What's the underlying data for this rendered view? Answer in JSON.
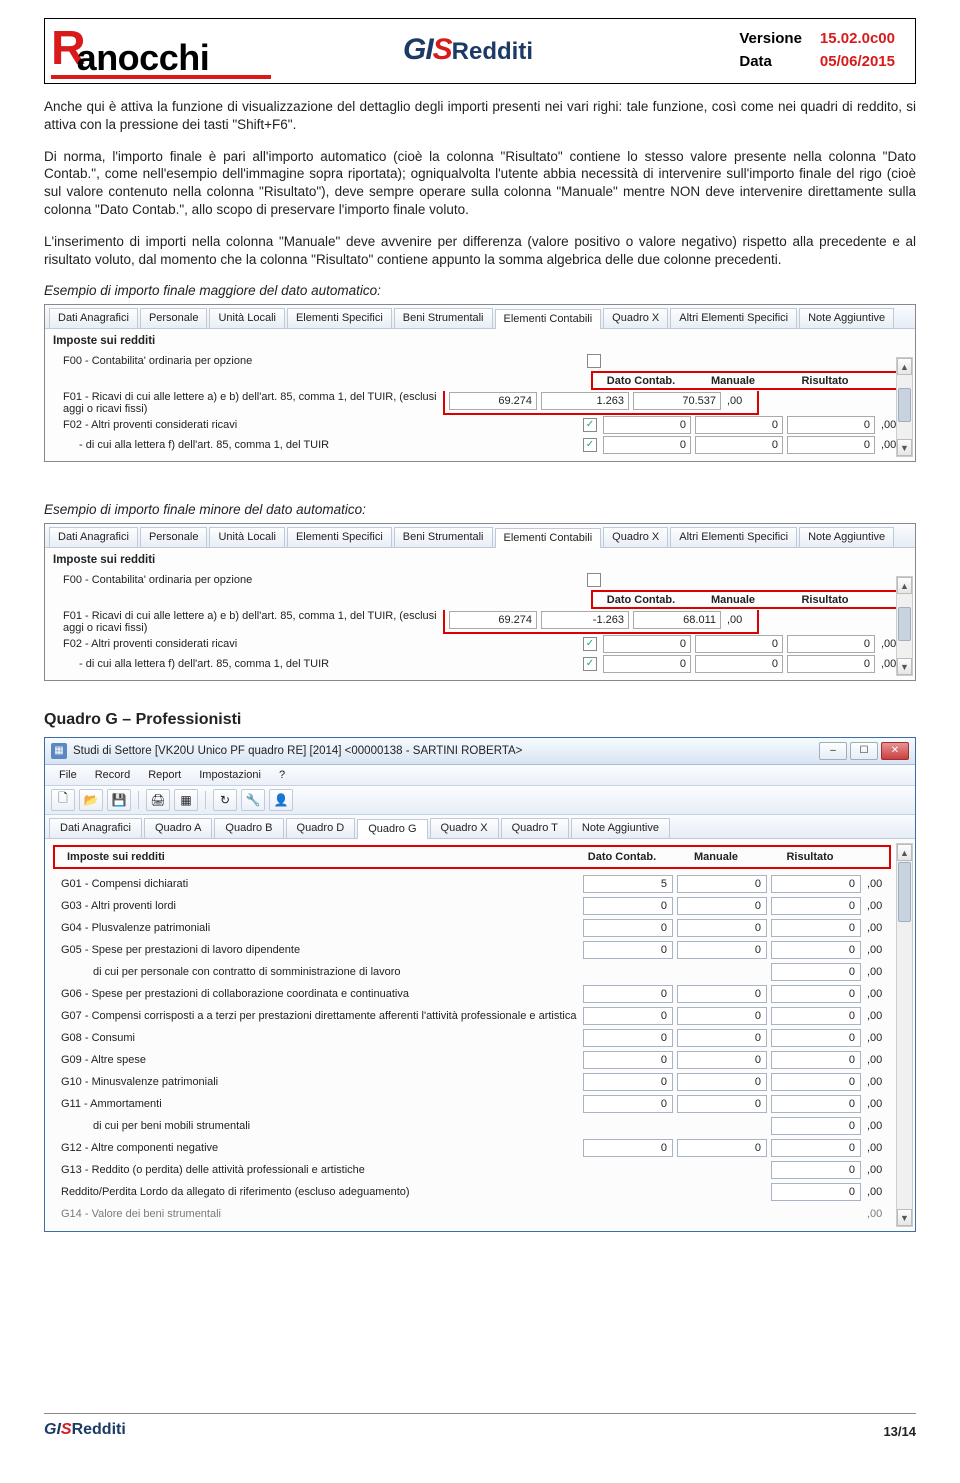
{
  "header": {
    "brand1": "R",
    "brand2": "anocchi",
    "gis": "GIS",
    "product": "Redditi",
    "version_label": "Versione",
    "version": "15.02.0c00",
    "date_label": "Data",
    "date": "05/06/2015"
  },
  "body": {
    "p1": "Anche qui è attiva la funzione di visualizzazione del dettaglio degli importi presenti nei vari righi: tale funzione, così come nei quadri di reddito, si attiva con la pressione dei tasti \"Shift+F6\".",
    "p2": "Di norma, l'importo finale è pari all'importo automatico (cioè la colonna \"Risultato\" contiene lo stesso valore presente nella colonna \"Dato Contab.\", come nell'esempio dell'immagine sopra riportata); ogniqualvolta l'utente abbia necessità di intervenire sull'importo finale del rigo (cioè sul valore contenuto nella colonna \"Risultato\"), deve sempre operare sulla colonna \"Manuale\" mentre NON deve intervenire direttamente sulla colonna \"Dato Contab.\", allo scopo di preservare l'importo finale voluto.",
    "p3": "L'inserimento di importi nella colonna \"Manuale\" deve avvenire per differenza (valore positivo o valore negativo) rispetto alla precedente e al risultato voluto, dal momento che la colonna \"Risultato\" contiene appunto la somma algebrica delle due colonne precedenti.",
    "cap1": "Esempio di importo finale maggiore del dato automatico:",
    "cap2": "Esempio di importo finale minore del dato automatico:",
    "section_g": "Quadro G – Professionisti"
  },
  "columns": {
    "dato": "Dato Contab.",
    "manuale": "Manuale",
    "risultato": "Risultato",
    "suffix": ",00"
  },
  "shot1": {
    "tabs": [
      "Dati Anagrafici",
      "Personale",
      "Unità Locali",
      "Elementi Specifici",
      "Beni Strumentali",
      "Elementi Contabili",
      "Quadro X",
      "Altri Elementi Specifici",
      "Note Aggiuntive"
    ],
    "active_tab": 5,
    "title": "Imposte sui redditi",
    "f00": "F00 - Contabilita' ordinaria per opzione",
    "f01": "F01 - Ricavi di cui alle lettere a) e b) dell'art. 85, comma 1, del TUIR, (esclusi aggi o ricavi fissi)",
    "f02": "F02 - Altri proventi considerati ricavi",
    "f02b": "- di cui alla lettera f) dell'art. 85, comma 1, del TUIR",
    "row1": {
      "dato": "69.274",
      "manuale": "1.263",
      "risultato": "70.537"
    },
    "row2": {
      "dato": "0",
      "manuale": "0",
      "risultato": "0"
    },
    "row3": {
      "dato": "0",
      "manuale": "0",
      "risultato": "0"
    }
  },
  "shot2": {
    "tabs": [
      "Dati Anagrafici",
      "Personale",
      "Unità Locali",
      "Elementi Specifici",
      "Beni Strumentali",
      "Elementi Contabili",
      "Quadro X",
      "Altri Elementi Specifici",
      "Note Aggiuntive"
    ],
    "active_tab": 5,
    "title": "Imposte sui redditi",
    "f00": "F00 - Contabilita' ordinaria per opzione",
    "f01": "F01 - Ricavi di cui alle lettere a) e b) dell'art. 85, comma 1, del TUIR, (esclusi aggi o ricavi fissi)",
    "f02": "F02 - Altri proventi considerati ricavi",
    "f02b": "- di cui alla lettera f) dell'art. 85, comma 1, del TUIR",
    "row1": {
      "dato": "69.274",
      "manuale": "-1.263",
      "risultato": "68.011"
    },
    "row2": {
      "dato": "0",
      "manuale": "0",
      "risultato": "0"
    },
    "row3": {
      "dato": "0",
      "manuale": "0",
      "risultato": "0"
    }
  },
  "quadro_g": {
    "window_title": "Studi di Settore [VK20U Unico PF quadro RE] [2014] <00000138 - SARTINI ROBERTA>",
    "menus": [
      "File",
      "Record",
      "Report",
      "Impostazioni",
      "?"
    ],
    "tabs": [
      "Dati Anagrafici",
      "Quadro A",
      "Quadro B",
      "Quadro D",
      "Quadro G",
      "Quadro X",
      "Quadro T",
      "Note Aggiuntive"
    ],
    "active_tab": 4,
    "title": "Imposte sui redditi",
    "rows": [
      {
        "lab": "G01 - Compensi dichiarati",
        "v": [
          "5",
          "0",
          "0"
        ]
      },
      {
        "lab": "G03 - Altri proventi lordi",
        "v": [
          "0",
          "0",
          "0"
        ]
      },
      {
        "lab": "G04 - Plusvalenze patrimoniali",
        "v": [
          "0",
          "0",
          "0"
        ]
      },
      {
        "lab": "G05 - Spese per prestazioni di lavoro dipendente",
        "v": [
          "0",
          "0",
          "0"
        ]
      },
      {
        "lab": "di cui per personale con contratto di somministrazione di lavoro",
        "indent": true,
        "v": [
          "",
          "",
          "0"
        ]
      },
      {
        "lab": "G06 - Spese per prestazioni di collaborazione coordinata e continuativa",
        "v": [
          "0",
          "0",
          "0"
        ]
      },
      {
        "lab": "G07 - Compensi corrisposti a a terzi per prestazioni direttamente afferenti l'attività professionale e artistica",
        "v": [
          "0",
          "0",
          "0"
        ]
      },
      {
        "lab": "G08 - Consumi",
        "v": [
          "0",
          "0",
          "0"
        ]
      },
      {
        "lab": "G09 - Altre spese",
        "v": [
          "0",
          "0",
          "0"
        ]
      },
      {
        "lab": "G10 - Minusvalenze patrimoniali",
        "v": [
          "0",
          "0",
          "0"
        ]
      },
      {
        "lab": "G11 - Ammortamenti",
        "v": [
          "0",
          "0",
          "0"
        ]
      },
      {
        "lab": "di cui per beni mobili strumentali",
        "indent": true,
        "v": [
          "",
          "",
          "0"
        ]
      },
      {
        "lab": "G12 - Altre componenti negative",
        "v": [
          "0",
          "0",
          "0"
        ]
      },
      {
        "lab": "G13 - Reddito (o perdita) delle attività professionali e artistiche",
        "v": [
          "",
          "",
          "0"
        ]
      },
      {
        "lab": "Reddito/Perdita Lordo da allegato di riferimento (escluso adeguamento)",
        "v": [
          "",
          "",
          "0"
        ]
      },
      {
        "lab": "G14 - Valore dei beni strumentali",
        "cut": true
      }
    ]
  },
  "footer": {
    "gis": "GIS",
    "product": "Redditi",
    "page": "13/14"
  }
}
